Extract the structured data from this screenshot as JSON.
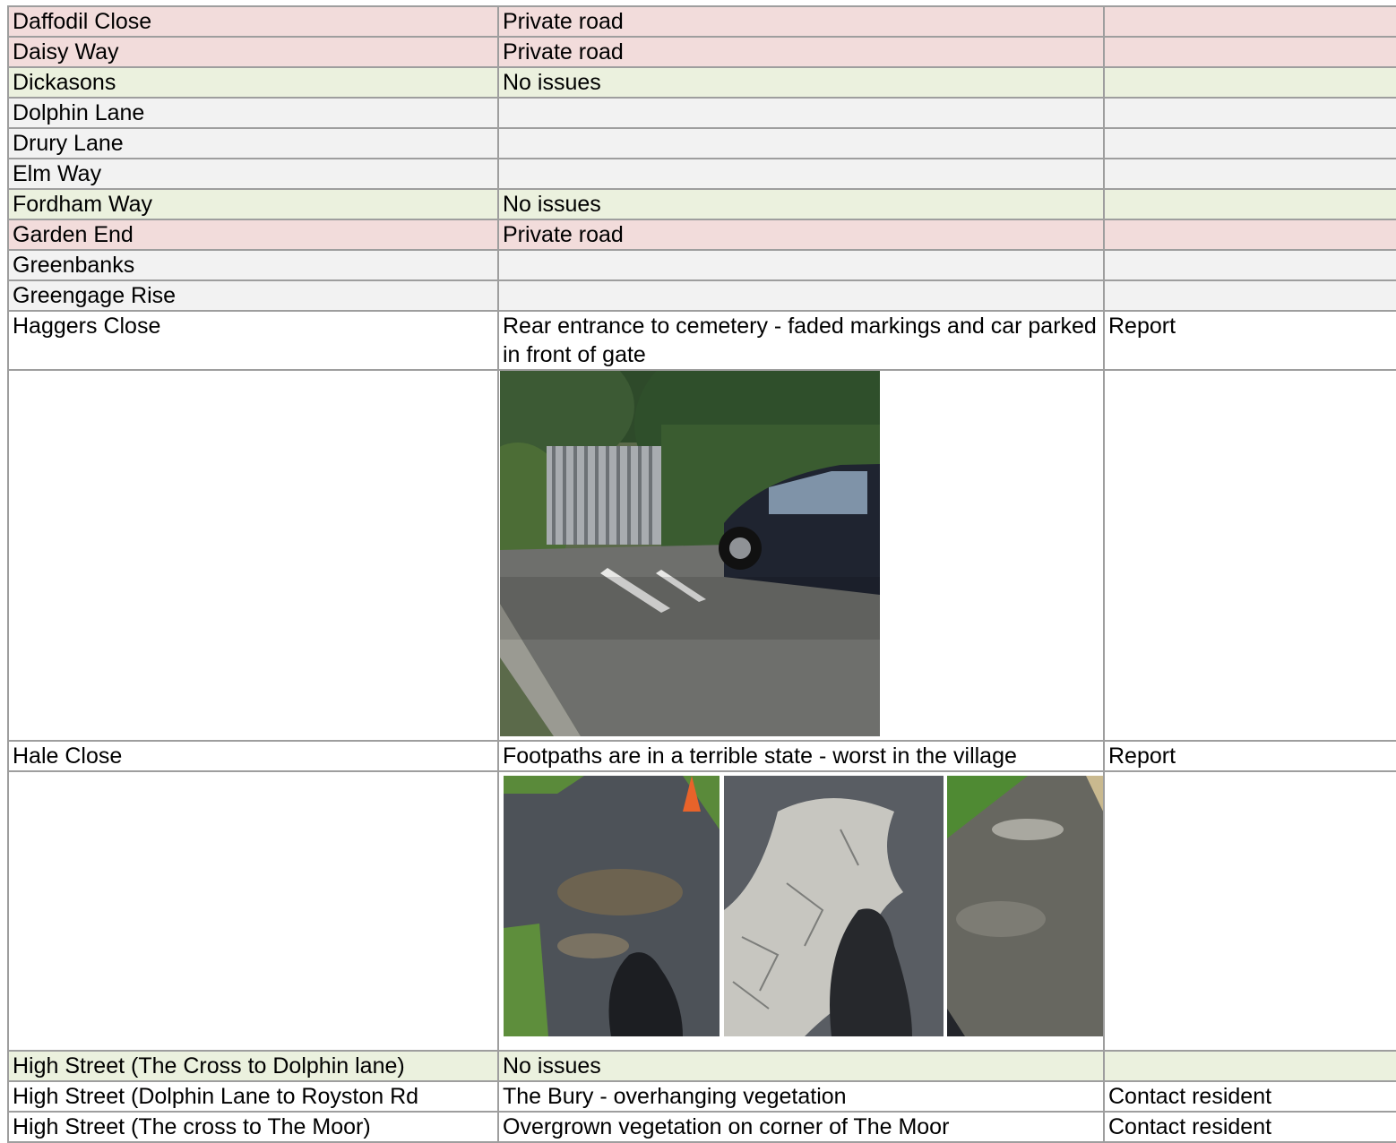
{
  "rows": [
    {
      "street": "Daffodil Close",
      "status": "Private road",
      "action": ""
    },
    {
      "street": "Daisy Way",
      "status": "Private road",
      "action": ""
    },
    {
      "street": "Dickasons",
      "status": "No issues",
      "action": ""
    },
    {
      "street": "Dolphin Lane",
      "status": "",
      "action": ""
    },
    {
      "street": "Drury Lane",
      "status": "",
      "action": ""
    },
    {
      "street": "Elm Way",
      "status": "",
      "action": ""
    },
    {
      "street": "Fordham Way",
      "status": "No issues",
      "action": ""
    },
    {
      "street": "Garden End",
      "status": "Private road",
      "action": ""
    },
    {
      "street": "Greenbanks",
      "status": "",
      "action": ""
    },
    {
      "street": "Greengage Rise",
      "status": "",
      "action": ""
    },
    {
      "street": "Haggers Close",
      "status": "Rear entrance to cemetery - faded markings and car parked in front of gate",
      "action": "Report"
    },
    {
      "street": "Hale Close",
      "status": "Footpaths are in a terrible state - worst in the village",
      "action": "Report"
    },
    {
      "street": "High Street  (The Cross to Dolphin lane)",
      "status": "No issues",
      "action": ""
    },
    {
      "street": "High Street (Dolphin Lane to Royston Rd",
      "status": "The Bury - overhanging vegetation",
      "action": "Contact resident"
    },
    {
      "street": "High Street (The cross to The Moor)",
      "status": "Overgrown vegetation on corner of The Moor",
      "action": "Contact resident"
    }
  ],
  "colors": {
    "private_road": "#f2dcdb",
    "no_issues": "#ebf1de",
    "blank": "#f2f2f2",
    "grid": "#9e9e9e"
  }
}
